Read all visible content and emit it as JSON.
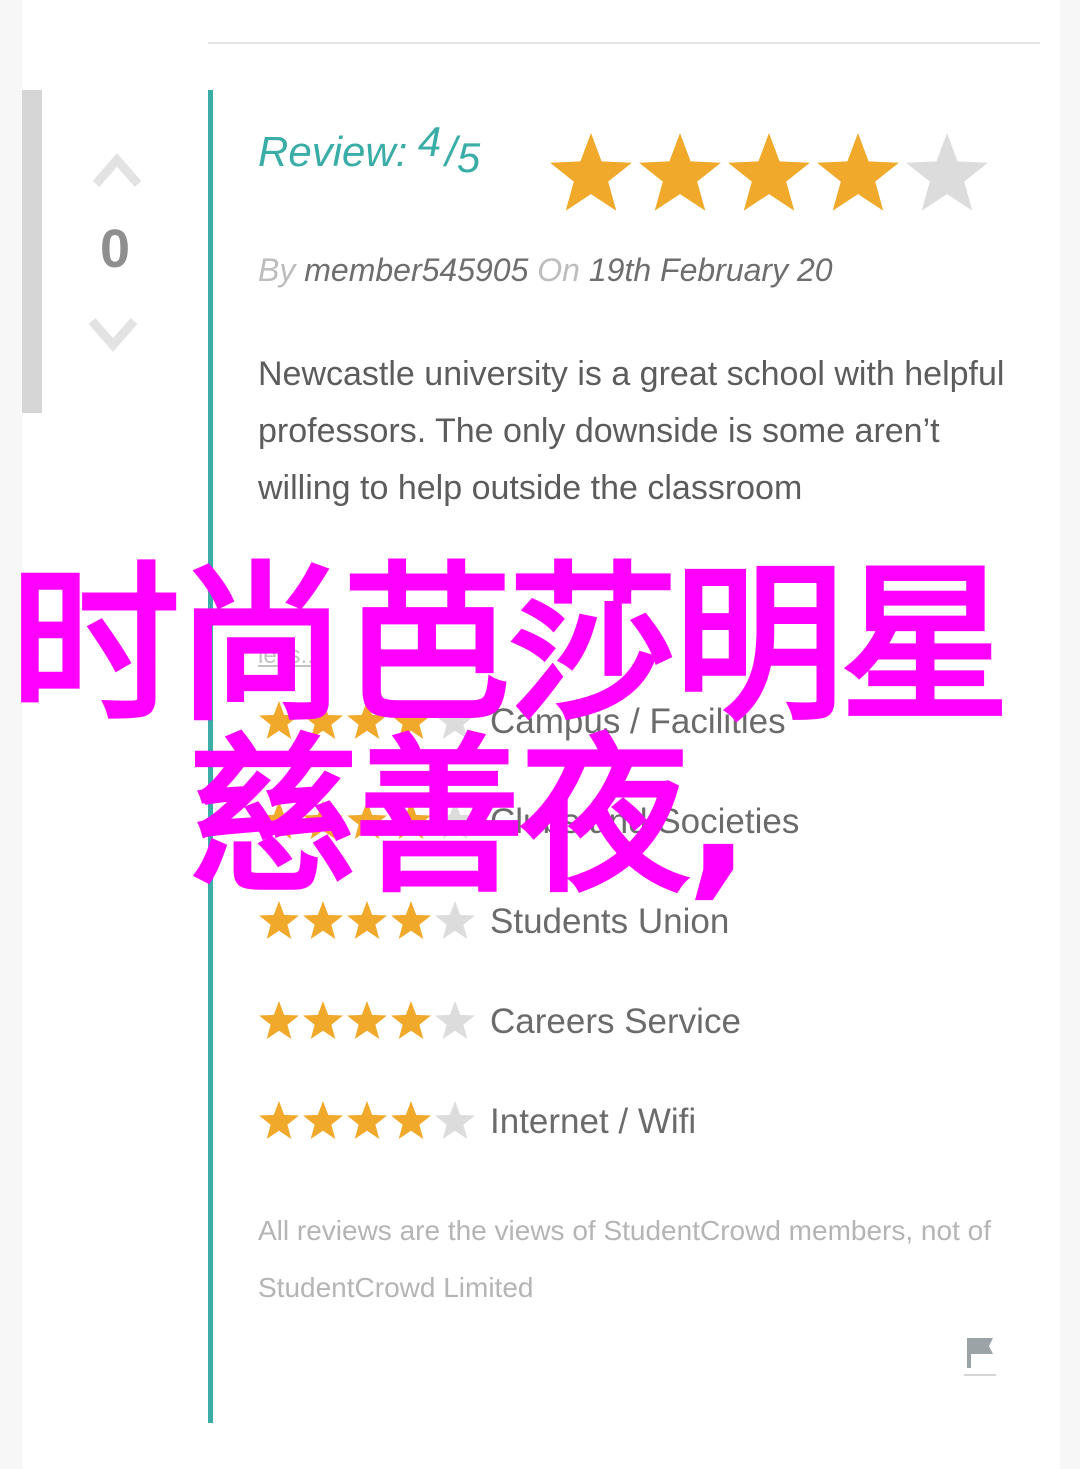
{
  "votes": {
    "count": "0"
  },
  "review": {
    "label": "Review:",
    "score": "4",
    "slash": "/",
    "out_of": "5",
    "stars": 4
  },
  "meta": {
    "by_label": "By",
    "author": "member545905",
    "on_label": "On",
    "date": "19th February 20"
  },
  "body": "Newcastle university is a great school with helpful professors. The only downside is some aren’t willing to help outside the classroom",
  "less_label": "less...",
  "ratings": [
    {
      "label": "Campus / Facilities",
      "stars": 4
    },
    {
      "label": "Clubs and Societies",
      "stars": 4
    },
    {
      "label": "Students Union",
      "stars": 4
    },
    {
      "label": "Careers Service",
      "stars": 4
    },
    {
      "label": "Internet / Wifi",
      "stars": 4
    }
  ],
  "disclaimer": "All reviews are the views of StudentCrowd members, not of StudentCrowd Limited",
  "overlay": {
    "line1": "时尚芭莎明星",
    "line2": "慈善夜,"
  },
  "colors": {
    "accent": "#3aada7",
    "star_filled": "#f0a92b",
    "star_empty": "#dcdcdc",
    "overlay": "#ff00ff"
  },
  "icons": {
    "vote_up": "chevron-up-icon",
    "vote_down": "chevron-down-icon",
    "report": "flag-icon"
  }
}
